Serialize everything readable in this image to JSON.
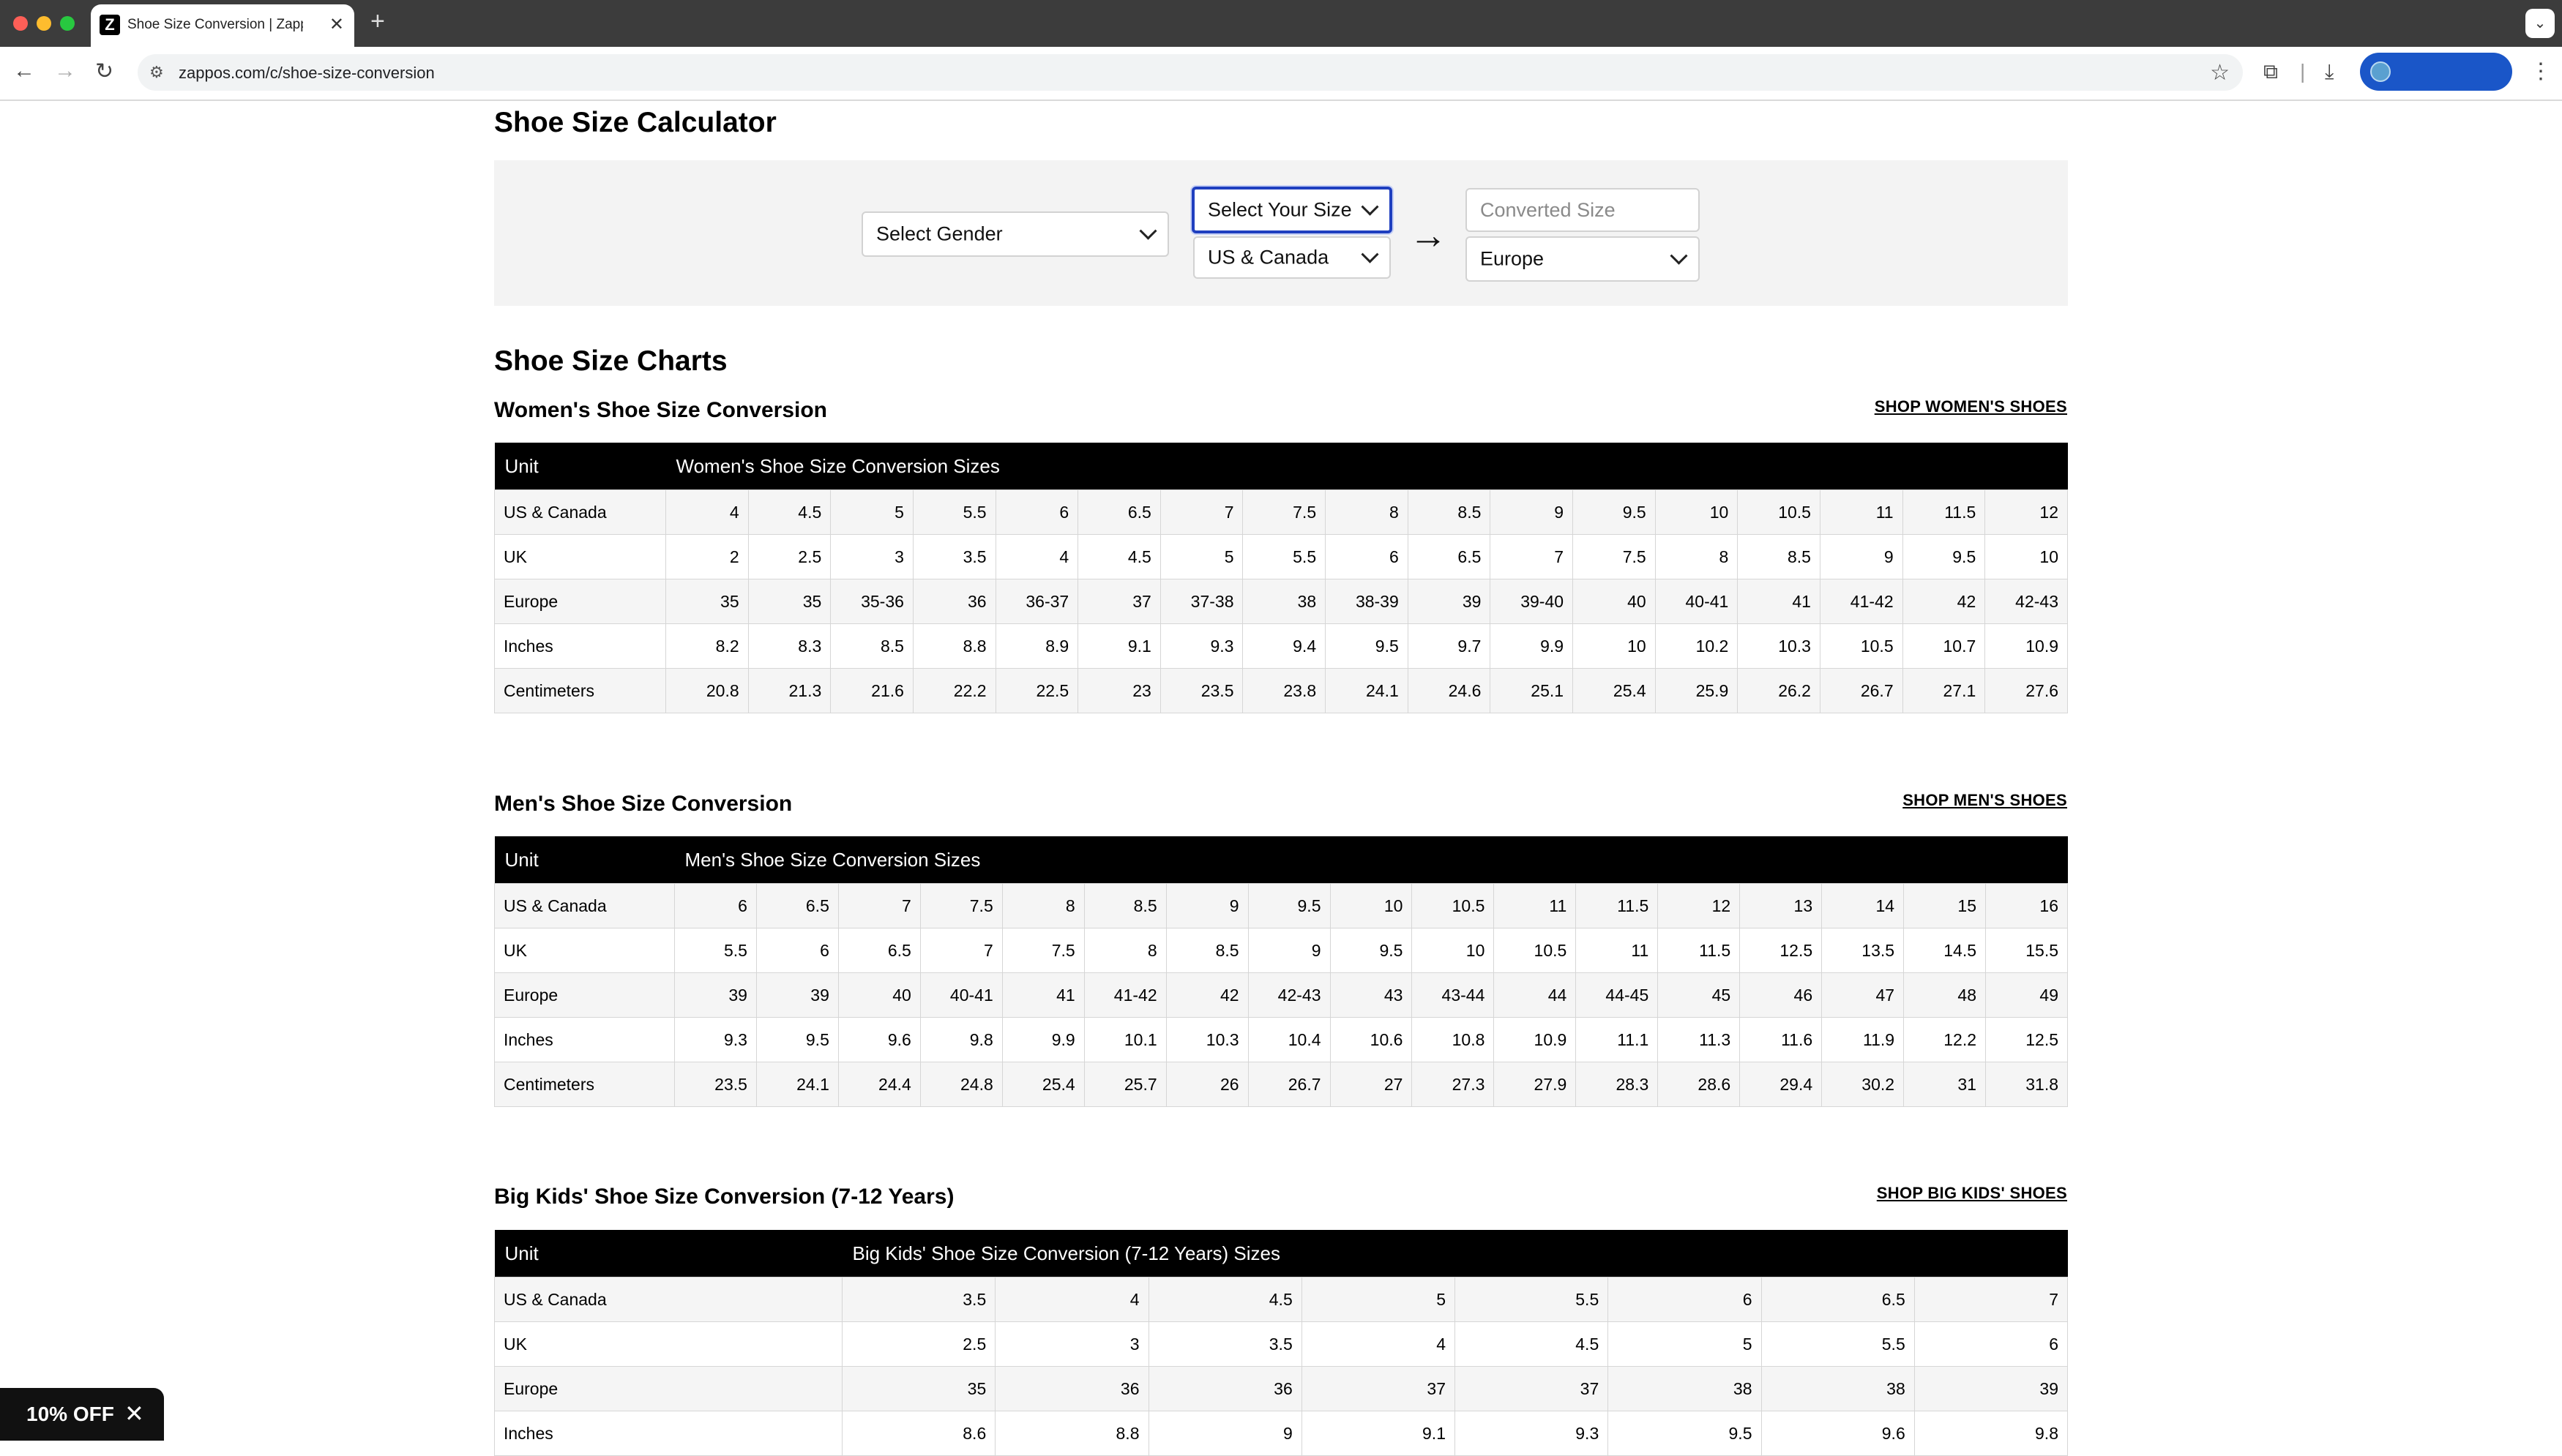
{
  "browser": {
    "tab_title": "Shoe Size Conversion | Zappos",
    "favicon_letter": "Z",
    "url": "zappos.com/c/shoe-size-conversion"
  },
  "calculator": {
    "title": "Shoe Size Calculator",
    "gender_select": "Select Gender",
    "size_select": "Select Your Size",
    "from_unit": "US & Canada",
    "converted_placeholder": "Converted Size",
    "to_unit": "Europe"
  },
  "charts_heading": "Shoe Size Charts",
  "womens": {
    "title": "Women's Shoe Size Conversion",
    "shop_link": "SHOP WOMEN'S SHOES",
    "unit_header": "Unit",
    "sizes_header": "Women's Shoe Size Conversion Sizes",
    "rows": [
      {
        "unit": "US & Canada",
        "values": [
          "4",
          "4.5",
          "5",
          "5.5",
          "6",
          "6.5",
          "7",
          "7.5",
          "8",
          "8.5",
          "9",
          "9.5",
          "10",
          "10.5",
          "11",
          "11.5",
          "12"
        ]
      },
      {
        "unit": "UK",
        "values": [
          "2",
          "2.5",
          "3",
          "3.5",
          "4",
          "4.5",
          "5",
          "5.5",
          "6",
          "6.5",
          "7",
          "7.5",
          "8",
          "8.5",
          "9",
          "9.5",
          "10"
        ]
      },
      {
        "unit": "Europe",
        "values": [
          "35",
          "35",
          "35-36",
          "36",
          "36-37",
          "37",
          "37-38",
          "38",
          "38-39",
          "39",
          "39-40",
          "40",
          "40-41",
          "41",
          "41-42",
          "42",
          "42-43"
        ]
      },
      {
        "unit": "Inches",
        "values": [
          "8.2",
          "8.3",
          "8.5",
          "8.8",
          "8.9",
          "9.1",
          "9.3",
          "9.4",
          "9.5",
          "9.7",
          "9.9",
          "10",
          "10.2",
          "10.3",
          "10.5",
          "10.7",
          "10.9"
        ]
      },
      {
        "unit": "Centimeters",
        "values": [
          "20.8",
          "21.3",
          "21.6",
          "22.2",
          "22.5",
          "23",
          "23.5",
          "23.8",
          "24.1",
          "24.6",
          "25.1",
          "25.4",
          "25.9",
          "26.2",
          "26.7",
          "27.1",
          "27.6"
        ]
      }
    ]
  },
  "mens": {
    "title": "Men's Shoe Size Conversion",
    "shop_link": "SHOP MEN'S SHOES",
    "unit_header": "Unit",
    "sizes_header": "Men's Shoe Size Conversion Sizes",
    "rows": [
      {
        "unit": "US & Canada",
        "values": [
          "6",
          "6.5",
          "7",
          "7.5",
          "8",
          "8.5",
          "9",
          "9.5",
          "10",
          "10.5",
          "11",
          "11.5",
          "12",
          "13",
          "14",
          "15",
          "16"
        ]
      },
      {
        "unit": "UK",
        "values": [
          "5.5",
          "6",
          "6.5",
          "7",
          "7.5",
          "8",
          "8.5",
          "9",
          "9.5",
          "10",
          "10.5",
          "11",
          "11.5",
          "12.5",
          "13.5",
          "14.5",
          "15.5"
        ]
      },
      {
        "unit": "Europe",
        "values": [
          "39",
          "39",
          "40",
          "40-41",
          "41",
          "41-42",
          "42",
          "42-43",
          "43",
          "43-44",
          "44",
          "44-45",
          "45",
          "46",
          "47",
          "48",
          "49"
        ]
      },
      {
        "unit": "Inches",
        "values": [
          "9.3",
          "9.5",
          "9.6",
          "9.8",
          "9.9",
          "10.1",
          "10.3",
          "10.4",
          "10.6",
          "10.8",
          "10.9",
          "11.1",
          "11.3",
          "11.6",
          "11.9",
          "12.2",
          "12.5"
        ]
      },
      {
        "unit": "Centimeters",
        "values": [
          "23.5",
          "24.1",
          "24.4",
          "24.8",
          "25.4",
          "25.7",
          "26",
          "26.7",
          "27",
          "27.3",
          "27.9",
          "28.3",
          "28.6",
          "29.4",
          "30.2",
          "31",
          "31.8"
        ]
      }
    ]
  },
  "bigkids": {
    "title": "Big Kids' Shoe Size Conversion (7-12 Years)",
    "shop_link": "SHOP BIG KIDS' SHOES",
    "unit_header": "Unit",
    "sizes_header": "Big Kids' Shoe Size Conversion (7-12 Years) Sizes",
    "rows": [
      {
        "unit": "US & Canada",
        "values": [
          "3.5",
          "4",
          "4.5",
          "5",
          "5.5",
          "6",
          "6.5",
          "7"
        ]
      },
      {
        "unit": "UK",
        "values": [
          "2.5",
          "3",
          "3.5",
          "4",
          "4.5",
          "5",
          "5.5",
          "6"
        ]
      },
      {
        "unit": "Europe",
        "values": [
          "35",
          "36",
          "36",
          "37",
          "37",
          "38",
          "38",
          "39"
        ]
      },
      {
        "unit": "Inches",
        "values": [
          "8.6",
          "8.8",
          "9",
          "9.1",
          "9.3",
          "9.5",
          "9.6",
          "9.8"
        ]
      }
    ]
  },
  "promo": {
    "label": "10% OFF"
  }
}
